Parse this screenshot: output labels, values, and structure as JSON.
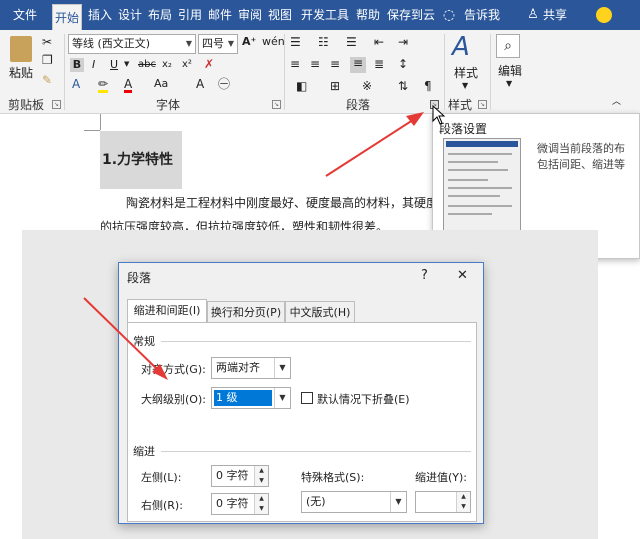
{
  "ribbon_tabs": {
    "file": "文件",
    "home": "开始",
    "insert": "插入",
    "design": "设计",
    "layout": "布局",
    "references": "引用",
    "mailings": "邮件",
    "review": "审阅",
    "view": "视图",
    "developer": "开发工具",
    "help": "帮助",
    "save_to_cloud": "保存到云",
    "tell_me": "告诉我",
    "share": "共享"
  },
  "clipboard": {
    "paste_label": "粘贴",
    "group_label": "剪贴板"
  },
  "font": {
    "font_name": "等线 (西文正文)",
    "font_size": "四号",
    "group_label": "字体"
  },
  "paragraph": {
    "group_label": "段落"
  },
  "styles": {
    "styles_label": "样式",
    "group_label": "样式"
  },
  "editing": {
    "edit_label": "编辑"
  },
  "tooltip": {
    "title": "段落设置",
    "desc_line1": "微调当前段落的布",
    "desc_line2": "包括间距、缩进等"
  },
  "document": {
    "heading": "1.力学特性",
    "para_line1": "陶瓷材料是工程材料中刚度最好、硬度最高的材料，其硬度大多",
    "para_line2": "的抗压强度较高，但抗拉强度较低，塑性和韧性很差。"
  },
  "dialog": {
    "title": "段落",
    "help_glyph": "?",
    "close_glyph": "✕",
    "tabs": [
      "缩进和间距(I)",
      "换行和分页(P)",
      "中文版式(H)"
    ],
    "general_header": "常规",
    "alignment_label": "对齐方式(G):",
    "alignment_value": "两端对齐",
    "outline_label": "大纲级别(O):",
    "outline_value": "1 级",
    "collapse_label": "默认情况下折叠(E)",
    "indent_header": "缩进",
    "left_label": "左侧(L):",
    "left_value": "0 字符",
    "right_label": "右侧(R):",
    "right_value": "0 字符",
    "special_label": "特殊格式(S):",
    "special_value": "(无)",
    "indent_value_label": "缩进值(Y):",
    "indent_value": ""
  },
  "colors": {
    "ribbon_blue": "#2b579a",
    "arrow_red": "#e53935",
    "selection_blue": "#0078d7"
  }
}
